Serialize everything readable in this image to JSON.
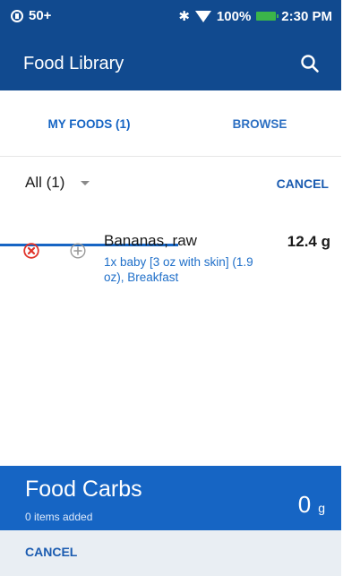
{
  "status_bar": {
    "left_text": "50+",
    "battery_text": "100%",
    "time": "2:30 PM",
    "icons": [
      "notification-icon",
      "bluetooth-icon",
      "wifi-icon",
      "battery-icon"
    ]
  },
  "header": {
    "title": "Food Library",
    "search_icon": "search-icon"
  },
  "tabs": [
    {
      "label": "MY FOODS (1)",
      "active": true
    },
    {
      "label": "BROWSE",
      "active": false
    }
  ],
  "filter": {
    "selected": "All (1)",
    "cancel_label": "CANCEL"
  },
  "food_item": {
    "name": "Bananas, raw",
    "detail": "1x baby [3 oz with skin] (1.9 oz), Breakfast",
    "carbs": "12.4 g",
    "remove_icon": "remove-circle-icon",
    "add_icon": "add-circle-icon"
  },
  "summary": {
    "title": "Food Carbs",
    "subtitle": "0 items added",
    "value": "0",
    "unit": "g"
  },
  "footer": {
    "cancel_label": "CANCEL"
  },
  "colors": {
    "header": "#114a8f",
    "accent": "#1665c4",
    "remove_red": "#e0332a",
    "bottom_bar": "#e9eef3"
  }
}
